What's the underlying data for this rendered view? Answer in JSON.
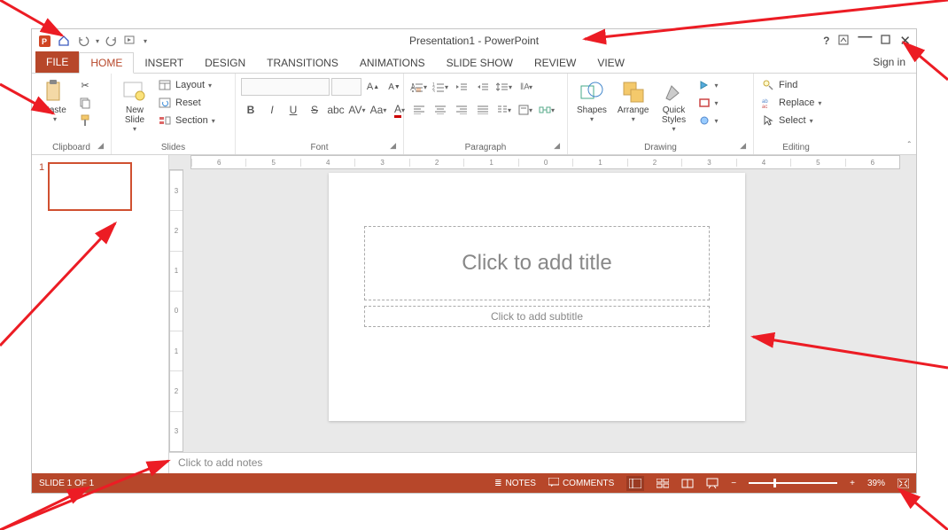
{
  "titlebar": {
    "title": "Presentation1 - PowerPoint"
  },
  "tabs": {
    "file": "FILE",
    "home": "HOME",
    "insert": "INSERT",
    "design": "DESIGN",
    "transitions": "TRANSITIONS",
    "animations": "ANIMATIONS",
    "slideshow": "SLIDE SHOW",
    "review": "REVIEW",
    "view": "VIEW",
    "signin": "Sign in"
  },
  "ribbon": {
    "clipboard": {
      "label": "Clipboard",
      "paste": "Paste"
    },
    "slides": {
      "label": "Slides",
      "newslide": "New\nSlide",
      "layout": "Layout",
      "reset": "Reset",
      "section": "Section"
    },
    "font": {
      "label": "Font"
    },
    "paragraph": {
      "label": "Paragraph"
    },
    "drawing": {
      "label": "Drawing",
      "shapes": "Shapes",
      "arrange": "Arrange",
      "quickstyles": "Quick\nStyles"
    },
    "editing": {
      "label": "Editing",
      "find": "Find",
      "replace": "Replace",
      "select": "Select"
    }
  },
  "slide": {
    "number": "1",
    "title_ph": "Click to add title",
    "subtitle_ph": "Click to add subtitle"
  },
  "ruler_h": [
    "6",
    "5",
    "4",
    "3",
    "2",
    "1",
    "0",
    "1",
    "2",
    "3",
    "4",
    "5",
    "6"
  ],
  "ruler_v": [
    "3",
    "2",
    "1",
    "0",
    "1",
    "2",
    "3"
  ],
  "notes": {
    "placeholder": "Click to add notes"
  },
  "statusbar": {
    "slide_of": "SLIDE 1 OF 1",
    "notes": "NOTES",
    "comments": "COMMENTS",
    "zoom": "39%"
  }
}
